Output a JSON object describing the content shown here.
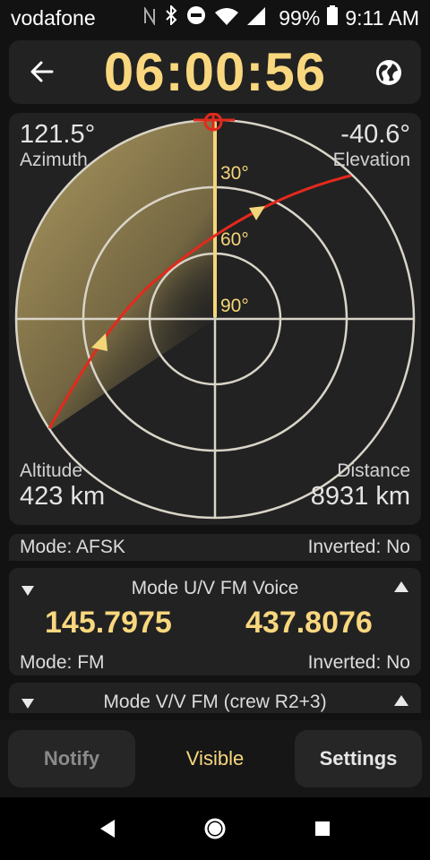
{
  "status_bar": {
    "carrier": "vodafone",
    "icons": [
      "nfc-icon",
      "bluetooth-icon",
      "do-not-disturb-icon",
      "wifi-icon",
      "cell-signal-icon",
      "battery-icon"
    ],
    "battery": "99%",
    "time": "9:11 AM"
  },
  "header": {
    "countdown": "06:00:56",
    "accent": "#f9d77e"
  },
  "radar": {
    "azimuth_value": "121.5°",
    "azimuth_label": "Azimuth",
    "elevation_value": "-40.6°",
    "elevation_label": "Elevation",
    "altitude_label": "Altitude",
    "altitude_value": "423 km",
    "distance_label": "Distance",
    "distance_value": "8931 km",
    "ring_labels": [
      "30°",
      "60°",
      "90°"
    ],
    "track_color": "#e4291c",
    "sweep_color": "#c9b271"
  },
  "mode_top": {
    "mode": "Mode: AFSK",
    "inverted": "Inverted: No"
  },
  "mode_uv": {
    "title": "Mode U/V FM Voice",
    "uplink": "145.7975",
    "downlink": "437.8076",
    "mode": "Mode: FM",
    "inverted": "Inverted: No"
  },
  "mode_vv": {
    "title": "Mode V/V FM (crew R2+3)"
  },
  "tabs": {
    "notify": "Notify",
    "visible": "Visible",
    "settings": "Settings"
  }
}
